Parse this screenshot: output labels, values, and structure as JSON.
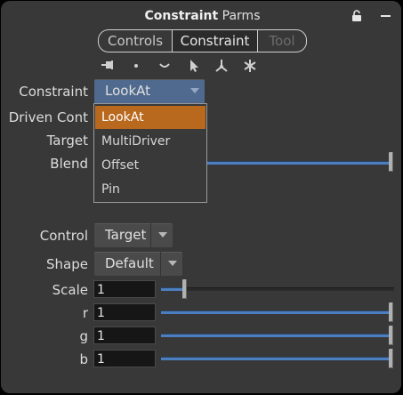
{
  "header": {
    "title_bold": "Constraint",
    "title_rest": " Parms"
  },
  "tabs": [
    {
      "label": "Controls",
      "state": "normal"
    },
    {
      "label": "Constraint",
      "state": "active"
    },
    {
      "label": "Tool",
      "state": "disabled"
    }
  ],
  "toolbar_icons": [
    "pin-tool-icon",
    "point-icon",
    "curve-icon",
    "select-arrow-icon",
    "transform-handle-icon",
    "asterisk-icon"
  ],
  "constraint": {
    "label": "Constraint",
    "value": "LookAt",
    "options": [
      "LookAt",
      "MultiDriver",
      "Offset",
      "Pin"
    ],
    "selected_index": 0
  },
  "params": {
    "driven_label": "Driven Cont",
    "target_label": "Target",
    "blend_label": "Blend",
    "blend_value": 1.0
  },
  "control": {
    "control_label": "Control",
    "control_value": "Target",
    "shape_label": "Shape",
    "shape_value": "Default",
    "scale_label": "Scale",
    "scale_value": "1",
    "scale_fraction": 0.1,
    "r_label": "r",
    "r_value": "1",
    "g_label": "g",
    "g_value": "1",
    "b_label": "b",
    "b_value": "1"
  },
  "colors": {
    "accent_blue": "#4c7fc0",
    "menu_selected": "#b8691e",
    "constraint_menu": "#4f6a8e"
  }
}
